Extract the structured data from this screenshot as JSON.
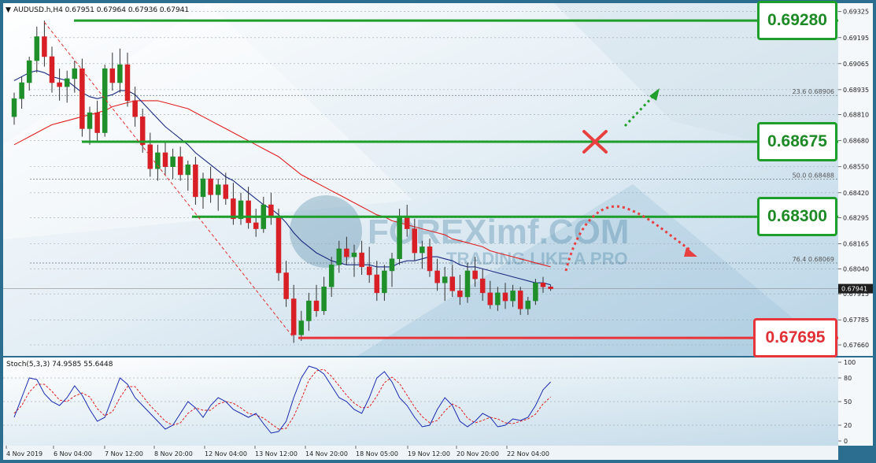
{
  "chart_data": {
    "type": "candlestick",
    "symbol_header": "AUDUSD.h,H4  0.67951 0.67964 0.67936 0.67941",
    "current_price": 0.67941,
    "ylim": [
      0.6766,
      0.6932
    ],
    "price_ticks": [
      "0.69325",
      "0.69195",
      "0.69065",
      "0.68935",
      "0.68810",
      "0.68680",
      "0.68550",
      "0.68420",
      "0.68295",
      "0.68165",
      "0.68040",
      "0.67915",
      "0.67785",
      "0.67660"
    ],
    "current_price_label": "0.67941",
    "time_labels": [
      "4 Nov 2019",
      "6 Nov 04:00",
      "7 Nov 12:00",
      "8 Nov 20:00",
      "12 Nov 04:00",
      "13 Nov 12:00",
      "14 Nov 20:00",
      "18 Nov 05:00",
      "19 Nov 12:00",
      "20 Nov 20:00",
      "22 Nov 04:00"
    ],
    "levels": [
      {
        "value": 0.6928,
        "label": "0.69280",
        "color": "#1e9e2a"
      },
      {
        "value": 0.68675,
        "label": "0.68675",
        "color": "#1e9e2a"
      },
      {
        "value": 0.683,
        "label": "0.68300",
        "color": "#1e9e2a"
      },
      {
        "value": 0.67695,
        "label": "0.67695",
        "color": "#e8353a"
      }
    ],
    "fib_levels": [
      {
        "label": "23.6 0.68906",
        "value": 0.68906
      },
      {
        "label": "50.0 0.68488",
        "value": 0.68488
      },
      {
        "label": "76.4 0.68069",
        "value": 0.68069
      }
    ],
    "ohlc": [
      [
        0.688,
        0.6892,
        0.6876,
        0.6889
      ],
      [
        0.6889,
        0.69,
        0.6884,
        0.6897
      ],
      [
        0.6897,
        0.691,
        0.6893,
        0.6908
      ],
      [
        0.6908,
        0.6925,
        0.6902,
        0.692
      ],
      [
        0.692,
        0.6928,
        0.6905,
        0.691
      ],
      [
        0.691,
        0.6915,
        0.6892,
        0.6897
      ],
      [
        0.6897,
        0.6904,
        0.6888,
        0.6895
      ],
      [
        0.6895,
        0.6903,
        0.6887,
        0.6899
      ],
      [
        0.6899,
        0.6908,
        0.6892,
        0.6904
      ],
      [
        0.6904,
        0.6909,
        0.687,
        0.6874
      ],
      [
        0.6874,
        0.6885,
        0.6866,
        0.6882
      ],
      [
        0.6882,
        0.6888,
        0.6868,
        0.6872
      ],
      [
        0.6872,
        0.6906,
        0.687,
        0.6904
      ],
      [
        0.6904,
        0.6912,
        0.6893,
        0.6897
      ],
      [
        0.6897,
        0.6914,
        0.6892,
        0.6906
      ],
      [
        0.6906,
        0.6912,
        0.6885,
        0.6888
      ],
      [
        0.6888,
        0.6895,
        0.6875,
        0.688
      ],
      [
        0.688,
        0.6884,
        0.6862,
        0.6866
      ],
      [
        0.6866,
        0.6872,
        0.685,
        0.6854
      ],
      [
        0.6854,
        0.6866,
        0.6848,
        0.6862
      ],
      [
        0.6862,
        0.6868,
        0.6851,
        0.6855
      ],
      [
        0.6855,
        0.6864,
        0.6849,
        0.686
      ],
      [
        0.686,
        0.6865,
        0.6848,
        0.6851
      ],
      [
        0.6851,
        0.6858,
        0.6843,
        0.6856
      ],
      [
        0.6856,
        0.686,
        0.6836,
        0.684
      ],
      [
        0.684,
        0.6852,
        0.6834,
        0.6849
      ],
      [
        0.6849,
        0.6855,
        0.6837,
        0.6841
      ],
      [
        0.6841,
        0.6849,
        0.6833,
        0.6846
      ],
      [
        0.6846,
        0.6852,
        0.6836,
        0.6839
      ],
      [
        0.6839,
        0.6847,
        0.6826,
        0.6829
      ],
      [
        0.6829,
        0.6842,
        0.6826,
        0.6838
      ],
      [
        0.6838,
        0.6845,
        0.6824,
        0.6827
      ],
      [
        0.6827,
        0.6834,
        0.682,
        0.6824
      ],
      [
        0.6824,
        0.684,
        0.6822,
        0.6836
      ],
      [
        0.6836,
        0.6842,
        0.6826,
        0.683
      ],
      [
        0.683,
        0.6834,
        0.6798,
        0.6802
      ],
      [
        0.6802,
        0.6808,
        0.6785,
        0.6789
      ],
      [
        0.6789,
        0.6796,
        0.6767,
        0.6771
      ],
      [
        0.6771,
        0.6783,
        0.6768,
        0.6778
      ],
      [
        0.6778,
        0.6792,
        0.6773,
        0.6788
      ],
      [
        0.6788,
        0.6796,
        0.678,
        0.6783
      ],
      [
        0.6783,
        0.68,
        0.6781,
        0.6795
      ],
      [
        0.6795,
        0.681,
        0.679,
        0.6806
      ],
      [
        0.6806,
        0.6818,
        0.6802,
        0.6814
      ],
      [
        0.6814,
        0.682,
        0.6806,
        0.681
      ],
      [
        0.681,
        0.6816,
        0.68,
        0.6812
      ],
      [
        0.6812,
        0.6818,
        0.6801,
        0.6805
      ],
      [
        0.6805,
        0.6815,
        0.6797,
        0.6801
      ],
      [
        0.6801,
        0.6808,
        0.6788,
        0.6792
      ],
      [
        0.6792,
        0.6806,
        0.6788,
        0.6803
      ],
      [
        0.6803,
        0.6812,
        0.6795,
        0.6809
      ],
      [
        0.6809,
        0.6834,
        0.6806,
        0.683
      ],
      [
        0.683,
        0.6836,
        0.682,
        0.6824
      ],
      [
        0.6824,
        0.6829,
        0.6808,
        0.6812
      ],
      [
        0.6812,
        0.6818,
        0.6804,
        0.6815
      ],
      [
        0.6815,
        0.6819,
        0.68,
        0.6803
      ],
      [
        0.6803,
        0.6809,
        0.6793,
        0.6797
      ],
      [
        0.6797,
        0.6805,
        0.6788,
        0.68
      ],
      [
        0.68,
        0.6806,
        0.679,
        0.6793
      ],
      [
        0.6793,
        0.6801,
        0.6786,
        0.679
      ],
      [
        0.679,
        0.6807,
        0.6787,
        0.6803
      ],
      [
        0.6803,
        0.681,
        0.6795,
        0.6799
      ],
      [
        0.6799,
        0.6804,
        0.6788,
        0.6792
      ],
      [
        0.6792,
        0.6798,
        0.6784,
        0.6786
      ],
      [
        0.6786,
        0.6795,
        0.6783,
        0.6792
      ],
      [
        0.6792,
        0.6797,
        0.6784,
        0.6788
      ],
      [
        0.6788,
        0.6796,
        0.6785,
        0.6793
      ],
      [
        0.6793,
        0.6795,
        0.6781,
        0.6784
      ],
      [
        0.6784,
        0.679,
        0.6781,
        0.6788
      ],
      [
        0.6788,
        0.6799,
        0.6786,
        0.6797
      ],
      [
        0.6797,
        0.68,
        0.6792,
        0.6795
      ],
      [
        0.6795,
        0.6796,
        0.6793,
        0.6794
      ]
    ],
    "ma_fast": [
      0.6898,
      0.69,
      0.6902,
      0.6903,
      0.6902,
      0.69,
      0.6899,
      0.6898,
      0.6895,
      0.6892,
      0.689,
      0.6889,
      0.689,
      0.6891,
      0.6893,
      0.6893,
      0.6891,
      0.6887,
      0.6883,
      0.6879,
      0.6875,
      0.6872,
      0.6869,
      0.6866,
      0.6862,
      0.6859,
      0.6856,
      0.6853,
      0.685,
      0.6848,
      0.6845,
      0.6842,
      0.6839,
      0.6836,
      0.6834,
      0.6831,
      0.6827,
      0.6822,
      0.6818,
      0.6815,
      0.6812,
      0.681,
      0.6808,
      0.6807,
      0.6806,
      0.6806,
      0.6806,
      0.6806,
      0.6805,
      0.6805,
      0.6805,
      0.6807,
      0.6808,
      0.6808,
      0.6809,
      0.681,
      0.681,
      0.6809,
      0.6808,
      0.6806,
      0.6805,
      0.6805,
      0.6804,
      0.6803,
      0.6802,
      0.6801,
      0.68,
      0.6799,
      0.6798,
      0.6797,
      0.6797,
      0.6796
    ],
    "ma_slow": [
      0.6866,
      0.6868,
      0.687,
      0.6872,
      0.6874,
      0.6876,
      0.6877,
      0.6878,
      0.6879,
      0.688,
      0.6881,
      0.6882,
      0.6883,
      0.6885,
      0.6886,
      0.6887,
      0.6888,
      0.6888,
      0.6888,
      0.6888,
      0.6887,
      0.6886,
      0.6885,
      0.6884,
      0.6882,
      0.688,
      0.6878,
      0.6876,
      0.6874,
      0.6872,
      0.687,
      0.6868,
      0.6866,
      0.6864,
      0.6862,
      0.686,
      0.6857,
      0.6854,
      0.6851,
      0.6849,
      0.6847,
      0.6845,
      0.6843,
      0.6841,
      0.6839,
      0.6837,
      0.6835,
      0.6833,
      0.6831,
      0.683,
      0.6828,
      0.6827,
      0.6826,
      0.6825,
      0.6824,
      0.6823,
      0.6822,
      0.6821,
      0.6819,
      0.6818,
      0.6817,
      0.6816,
      0.6815,
      0.6813,
      0.6812,
      0.6811,
      0.681,
      0.6809,
      0.6808,
      0.6807,
      0.6806,
      0.6805
    ],
    "stochastic": {
      "label": "Stoch(5,3,3) 74.9585 55.6448",
      "ylim": [
        0,
        100
      ],
      "ticks": [
        "100",
        "80",
        "50",
        "20",
        "0"
      ],
      "main": [
        30,
        55,
        80,
        78,
        60,
        50,
        45,
        55,
        70,
        58,
        40,
        25,
        30,
        55,
        80,
        72,
        55,
        45,
        35,
        25,
        15,
        20,
        35,
        50,
        42,
        30,
        45,
        55,
        50,
        40,
        35,
        30,
        35,
        22,
        10,
        12,
        25,
        55,
        80,
        95,
        92,
        85,
        70,
        55,
        50,
        40,
        35,
        55,
        80,
        88,
        75,
        55,
        45,
        30,
        18,
        20,
        40,
        55,
        45,
        25,
        18,
        25,
        35,
        30,
        18,
        20,
        28,
        26,
        30,
        45,
        65,
        75
      ],
      "signal": [
        35,
        45,
        62,
        72,
        72,
        63,
        52,
        50,
        57,
        61,
        56,
        41,
        32,
        37,
        55,
        69,
        69,
        57,
        45,
        35,
        25,
        20,
        23,
        35,
        42,
        39,
        39,
        47,
        50,
        48,
        42,
        35,
        33,
        29,
        22,
        15,
        16,
        31,
        53,
        77,
        89,
        91,
        82,
        70,
        58,
        48,
        42,
        43,
        57,
        74,
        81,
        73,
        58,
        43,
        31,
        23,
        26,
        38,
        47,
        42,
        29,
        23,
        26,
        30,
        28,
        23,
        22,
        25,
        28,
        34,
        47,
        56
      ]
    }
  },
  "watermark": {
    "brand": "FOREXimf.COM",
    "tagline": "TRADING LIKE A PRO"
  }
}
